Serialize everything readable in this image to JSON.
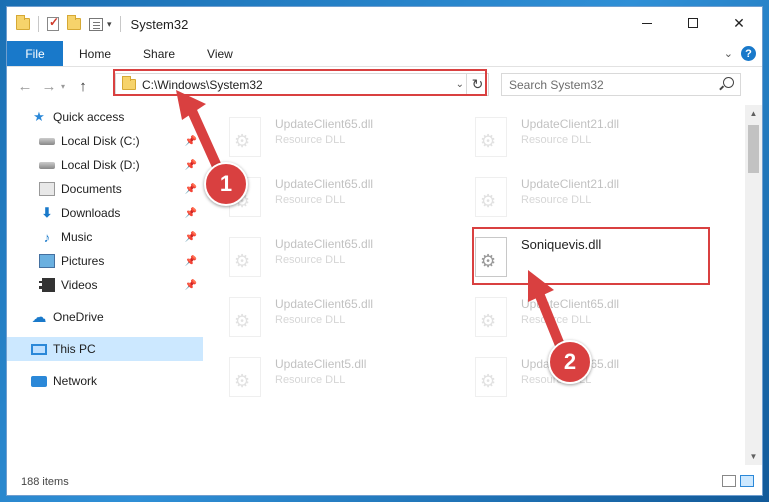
{
  "window": {
    "title": "System32",
    "controls": {
      "minimize": "minimize-icon",
      "maximize": "maximize-icon",
      "close": "✕"
    }
  },
  "ribbon": {
    "tabs": [
      {
        "label": "File",
        "active": true
      },
      {
        "label": "Home"
      },
      {
        "label": "Share"
      },
      {
        "label": "View"
      }
    ],
    "help": "?"
  },
  "navigation": {
    "address": "C:\\Windows\\System32",
    "search_placeholder": "Search System32"
  },
  "sidebar": {
    "quick_access": "Quick access",
    "pinned": [
      {
        "label": "Local Disk (C:)",
        "icon": "disk-icon"
      },
      {
        "label": "Local Disk (D:)",
        "icon": "disk-icon"
      },
      {
        "label": "Documents",
        "icon": "documents-icon"
      },
      {
        "label": "Downloads",
        "icon": "downloads-icon"
      },
      {
        "label": "Music",
        "icon": "music-icon"
      },
      {
        "label": "Pictures",
        "icon": "pictures-icon"
      },
      {
        "label": "Videos",
        "icon": "videos-icon"
      }
    ],
    "onedrive": "OneDrive",
    "this_pc": "This PC",
    "network": "Network"
  },
  "files": [
    {
      "name": "UpdateClient65.dll",
      "type": "Resource DLL",
      "faded": true
    },
    {
      "name": "UpdateClient21.dll",
      "type": "Resource DLL",
      "faded": true
    },
    {
      "name": "UpdateClient65.dll",
      "type": "Resource DLL",
      "faded": true
    },
    {
      "name": "UpdateClient21.dll",
      "type": "Resource DLL",
      "faded": true
    },
    {
      "name": "UpdateClient65.dll",
      "type": "Resource DLL",
      "faded": true
    },
    {
      "name": "Soniquevis.dll",
      "type": "",
      "faded": false
    },
    {
      "name": "UpdateClient65.dll",
      "type": "Resource DLL",
      "faded": true
    },
    {
      "name": "UpdateClient65.dll",
      "type": "Resource DLL",
      "faded": true
    },
    {
      "name": "UpdateClient5.dll",
      "type": "Resource DLL",
      "faded": true
    },
    {
      "name": "UpdateClient65.dll",
      "type": "Resource DLL",
      "faded": true
    }
  ],
  "status": {
    "item_count": "188 items"
  },
  "annotations": {
    "step1": "1",
    "step2": "2",
    "color": "#d94040"
  }
}
